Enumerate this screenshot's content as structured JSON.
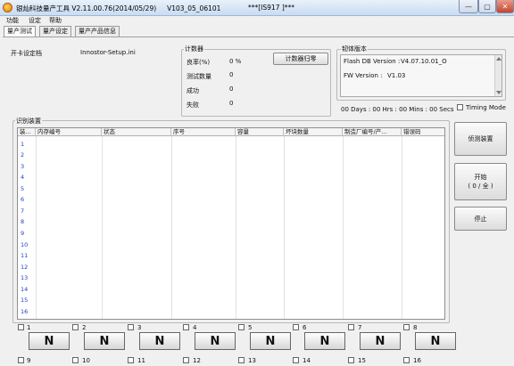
{
  "window": {
    "title": "银灿科技量产工具 V2.11.00.76(2014/05/29)     V103_05_06101",
    "center_title": "***[IS917 ]***",
    "minimize": "—",
    "maximize": "▢",
    "close": "✕"
  },
  "menu": [
    "功能",
    "设定",
    "帮助"
  ],
  "tabs": [
    "量产测试",
    "量产设定",
    "量产产品信息"
  ],
  "startup": {
    "label": "开卡设定档",
    "value": "Innostor-Setup.ini"
  },
  "counter": {
    "title": "计数器",
    "rows": [
      {
        "label": "良率(%)",
        "value": "0 %"
      },
      {
        "label": "测试数量",
        "value": "0"
      },
      {
        "label": "成功",
        "value": "0"
      },
      {
        "label": "失败",
        "value": "0"
      }
    ],
    "reset_button": "计数器归零"
  },
  "firmware": {
    "title": "韧体版本",
    "flash_db_label": "Flash DB Version :",
    "flash_db_value": "V4.07.10.01_O",
    "fw_label": "FW Version :",
    "fw_value": "V1.03"
  },
  "timer": "00 Days : 00 Hrs : 00 Mins : 00 Secs",
  "timing_mode": {
    "label": "Timing Mode",
    "checked": false
  },
  "devices": {
    "title": "识别装置",
    "columns": [
      "装...",
      "内存编号",
      "状态",
      "序号",
      "容量",
      "坏块数量",
      "制造厂编号/产...",
      "错误码"
    ],
    "rows": [
      "1",
      "2",
      "3",
      "4",
      "5",
      "6",
      "7",
      "8",
      "9",
      "10",
      "11",
      "12",
      "13",
      "14",
      "15",
      "16"
    ]
  },
  "side_buttons": {
    "detect": "侦测装置",
    "start_line1": "开始",
    "start_line2": "( 0 / 全 ) ",
    "stop": "停止"
  },
  "ports": [
    {
      "label": "1",
      "button": "N"
    },
    {
      "label": "2",
      "button": "N"
    },
    {
      "label": "3",
      "button": "N"
    },
    {
      "label": "4",
      "button": "N"
    },
    {
      "label": "5",
      "button": "N"
    },
    {
      "label": "6",
      "button": "N"
    },
    {
      "label": "7",
      "button": "N"
    },
    {
      "label": "8",
      "button": "N"
    }
  ],
  "ports_row2": [
    "9",
    "10",
    "11",
    "12",
    "13",
    "14",
    "15",
    "16"
  ]
}
